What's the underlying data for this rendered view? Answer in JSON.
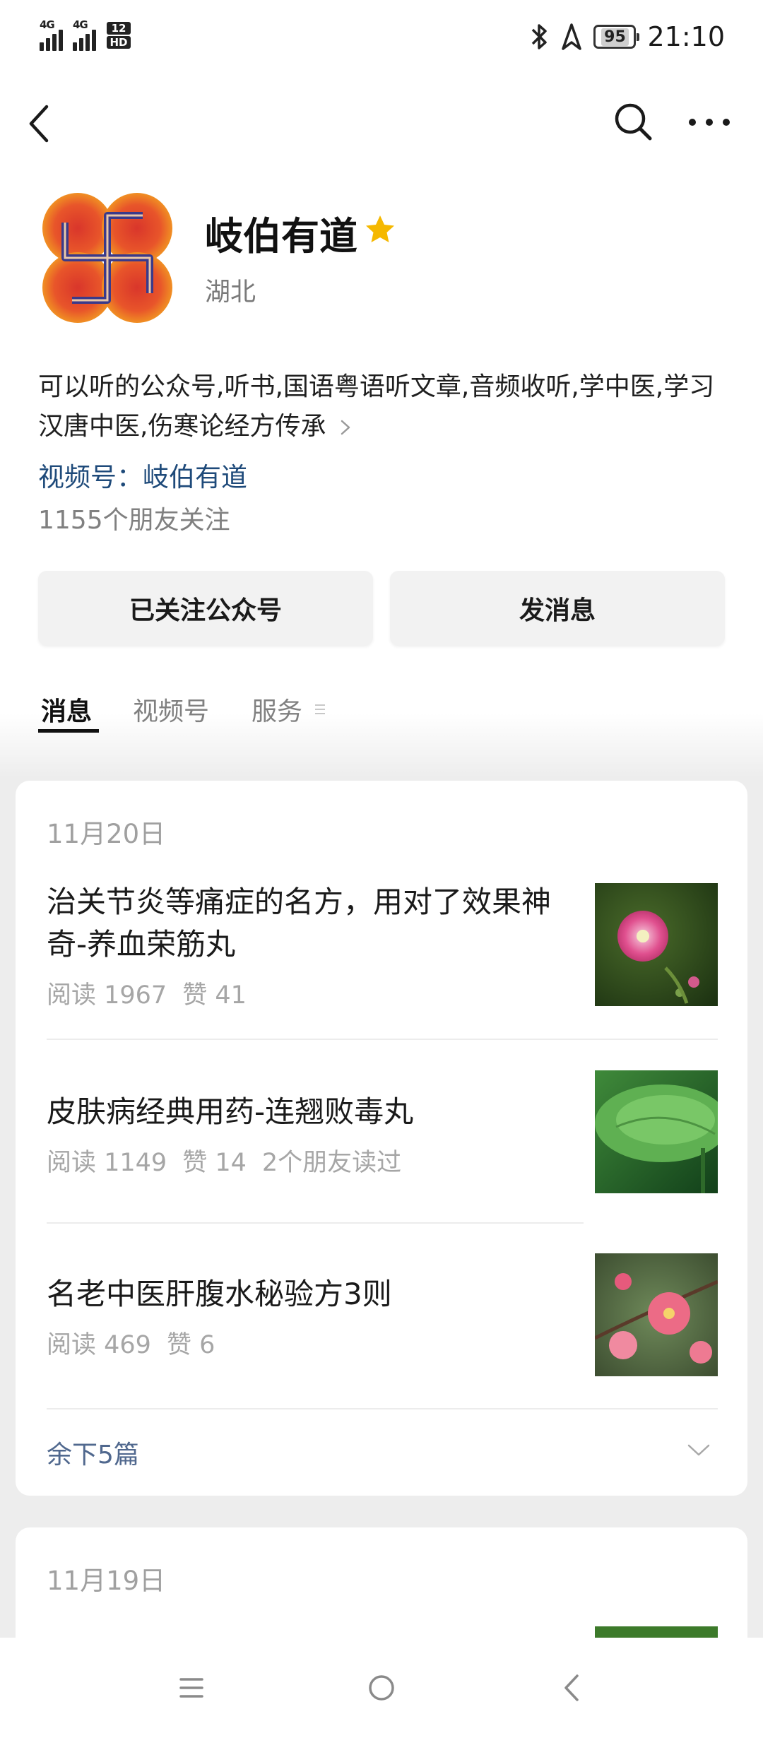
{
  "status_bar": {
    "signal_1_label": "4G",
    "signal_2_label": "4G",
    "hd_top": "12",
    "hd_bottom": "HD",
    "battery": "95",
    "time": "21:10",
    "icons": [
      "bluetooth-icon",
      "location-icon",
      "battery-icon"
    ]
  },
  "nav": {
    "icons": [
      "back-icon",
      "search-icon",
      "more-icon"
    ]
  },
  "profile": {
    "name": "岐伯有道",
    "region": "湖北",
    "description": "可以听的公众号,听书,国语粤语听文章,音频收听,学中医,学习汉唐中医,伤寒论经方传承",
    "channel": "视频号：岐伯有道",
    "followers": "1155个朋友关注",
    "star_color": "#f5b800"
  },
  "actions": {
    "follow_label": "已关注公众号",
    "message_label": "发消息"
  },
  "tabs": [
    {
      "label": "消息",
      "active": true
    },
    {
      "label": "视频号",
      "active": false
    },
    {
      "label": "服务",
      "active": false
    }
  ],
  "groups": [
    {
      "date": "11月20日",
      "articles": [
        {
          "title": "治关节炎等痛症的名方，用对了效果神奇-养血荣筋丸",
          "reads": "阅读 1967",
          "likes": "赞 41",
          "friends": "",
          "thumb": "pink-flower-thumbnail"
        },
        {
          "title": "皮肤病经典用药-连翘败毒丸",
          "reads": "阅读 1149",
          "likes": "赞 14",
          "friends": "2个朋友读过",
          "thumb": "lotus-leaf-thumbnail"
        },
        {
          "title": "名老中医肝腹水秘验方3则",
          "reads": "阅读 469",
          "likes": "赞 6",
          "friends": "",
          "thumb": "peach-blossom-thumbnail"
        }
      ],
      "more_label": "余下5篇"
    },
    {
      "date": "11月19日",
      "articles": []
    }
  ],
  "system_nav": {
    "icons": [
      "menu-icon",
      "home-icon",
      "back-triangle-icon"
    ]
  }
}
